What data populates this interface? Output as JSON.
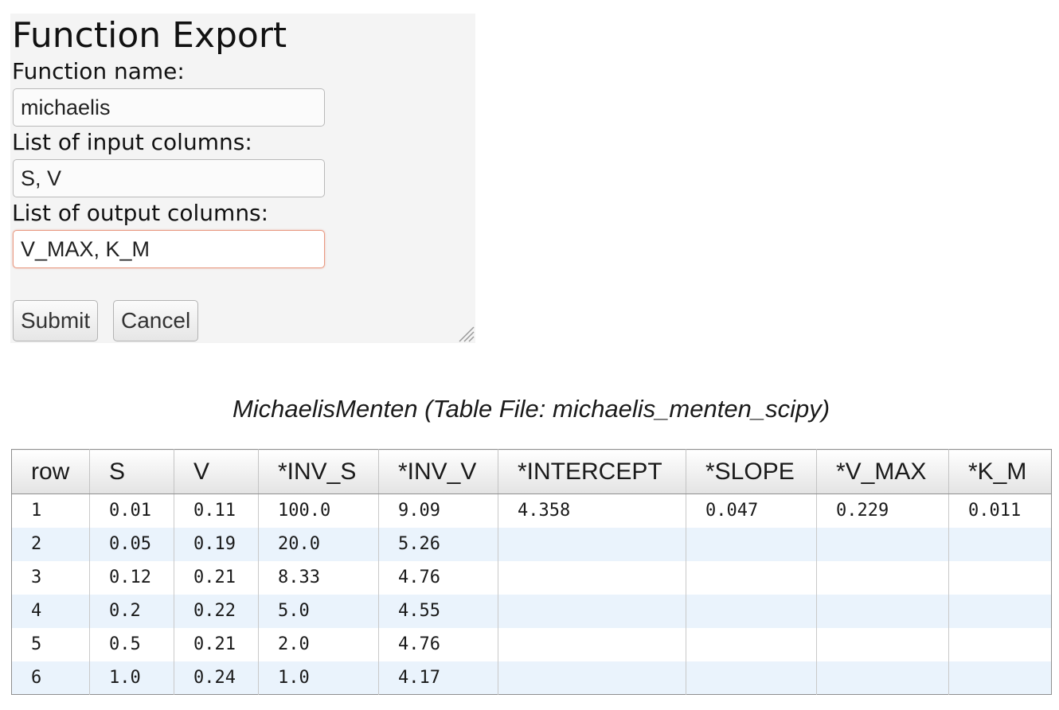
{
  "dialog": {
    "title": "Function Export",
    "fields": [
      {
        "label": "Function name:",
        "value": "michaelis"
      },
      {
        "label": "List of input columns:",
        "value": "S, V"
      },
      {
        "label": "List of output columns:",
        "value": "V_MAX, K_M"
      }
    ],
    "submit_label": "Submit",
    "cancel_label": "Cancel"
  },
  "table": {
    "caption": "MichaelisMenten (Table File: michaelis_menten_scipy)",
    "columns": [
      "row",
      "S",
      "V",
      "*INV_S",
      "*INV_V",
      "*INTERCEPT",
      "*SLOPE",
      "*V_MAX",
      "*K_M"
    ],
    "rows": [
      [
        "1",
        "0.01",
        "0.11",
        "100.0",
        "9.09",
        "4.358",
        "0.047",
        "0.229",
        "0.011"
      ],
      [
        "2",
        "0.05",
        "0.19",
        "20.0",
        "5.26",
        "",
        "",
        "",
        ""
      ],
      [
        "3",
        "0.12",
        "0.21",
        "8.33",
        "4.76",
        "",
        "",
        "",
        ""
      ],
      [
        "4",
        "0.2",
        "0.22",
        "5.0",
        "4.55",
        "",
        "",
        "",
        ""
      ],
      [
        "5",
        "0.5",
        "0.21",
        "2.0",
        "4.76",
        "",
        "",
        "",
        ""
      ],
      [
        "6",
        "1.0",
        "0.24",
        "1.0",
        "4.17",
        "",
        "",
        "",
        ""
      ]
    ],
    "row_stripe_color": "#eaf3fc",
    "focus_border_color": "#e89a82"
  }
}
